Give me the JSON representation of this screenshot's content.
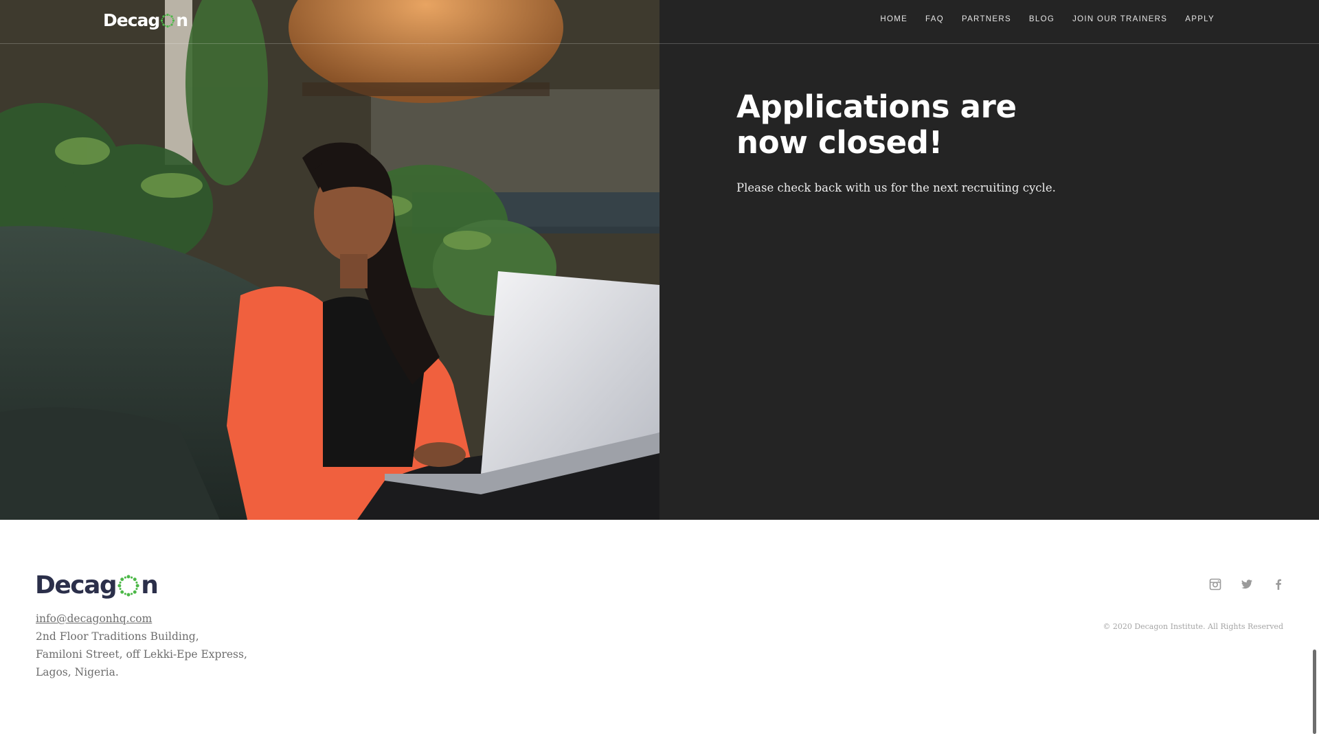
{
  "brand": {
    "name": "Decagon",
    "word_left": "Decag",
    "word_right": "n",
    "dot_color": "#4cb848"
  },
  "nav": {
    "links": [
      "HOME",
      "FAQ",
      "PARTNERS",
      "BLOG",
      "JOIN OUR TRAINERS",
      "APPLY"
    ]
  },
  "hero": {
    "title": "Applications are now closed!",
    "subtitle": "Please check back with us for the next recruiting cycle.",
    "panel_color": "#242424"
  },
  "footer": {
    "email": "info@decagonhq.com",
    "address": [
      "2nd Floor Traditions Building,",
      "Familoni Street, off Lekki-Epe Express,",
      "Lagos, Nigeria."
    ],
    "copyright": "© 2020 Decagon Institute. All Rights Reserved",
    "socials": [
      "instagram-icon",
      "twitter-icon",
      "facebook-icon"
    ]
  }
}
